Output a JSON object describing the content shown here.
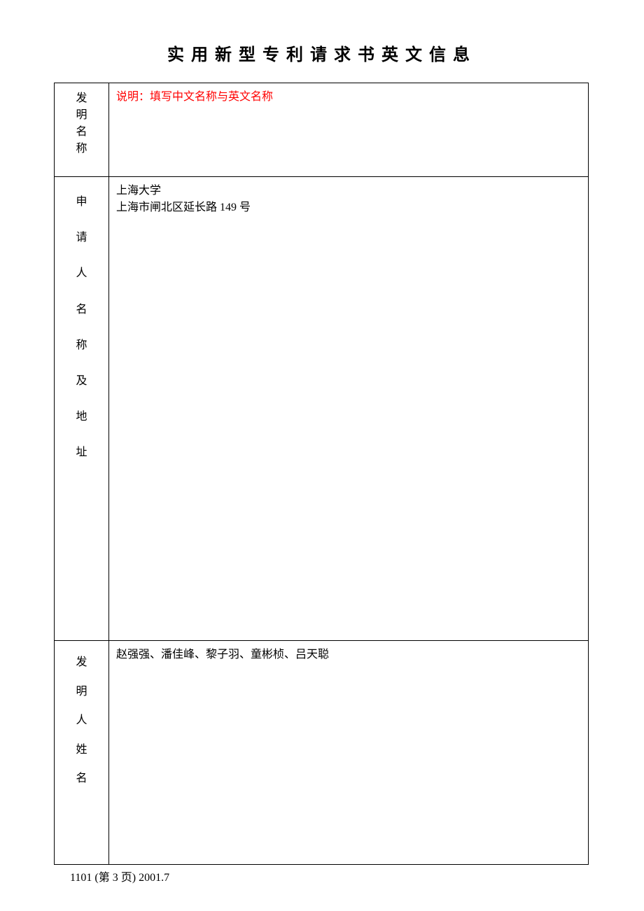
{
  "title": "实用新型专利请求书英文信息",
  "rows": {
    "invention_name": {
      "label_chars": [
        "发",
        "明",
        "名",
        "称"
      ],
      "instruction": "说明：填写中文名称与英文名称"
    },
    "applicant": {
      "label_chars": [
        "申",
        "请",
        "人",
        "名",
        "称",
        "及",
        "地",
        "址"
      ],
      "line1": "上海大学",
      "line2": "上海市闸北区延长路 149 号"
    },
    "inventor": {
      "label_chars": [
        "发",
        "明",
        "人",
        "姓",
        "名"
      ],
      "names": "赵强强、潘佳峰、黎子羽、童彬桢、吕天聪"
    }
  },
  "footer": "1101 (第 3 页)   2001.7"
}
